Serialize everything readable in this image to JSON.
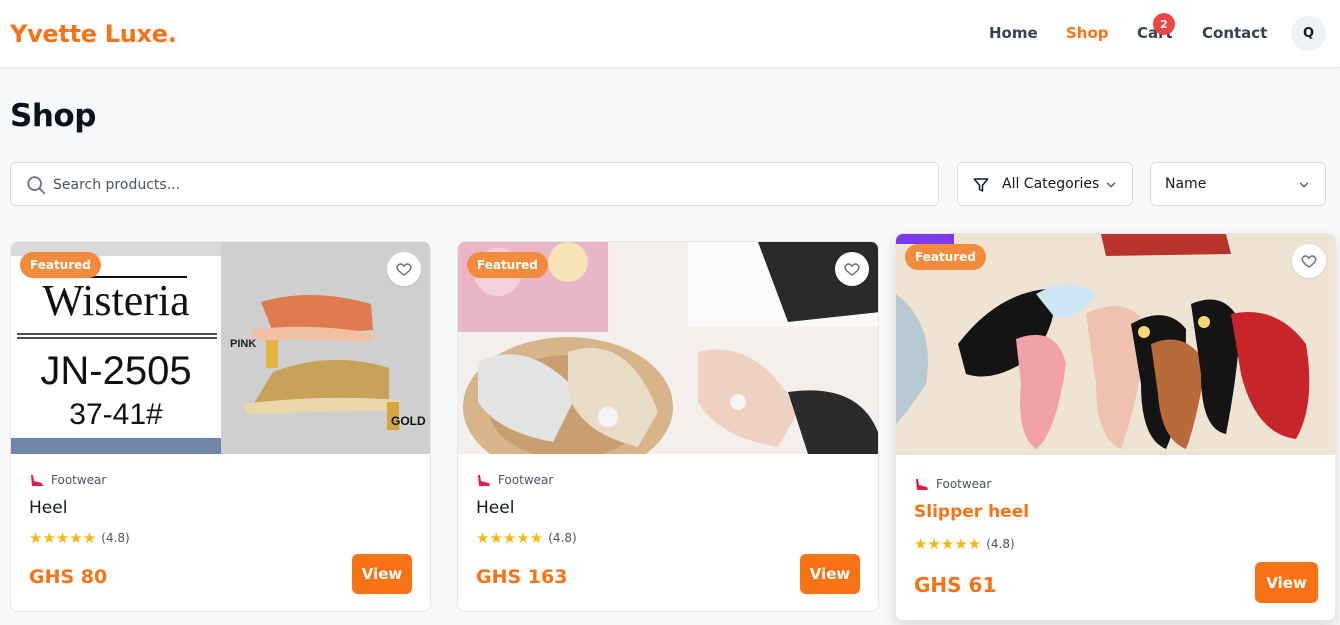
{
  "brand": {
    "name": "Yvette Luxe.",
    "accent_color": "#f97316"
  },
  "nav": {
    "home": "Home",
    "shop": "Shop",
    "cart": "Cart",
    "cart_count": "2",
    "contact": "Contact",
    "avatar_initial": "Q"
  },
  "page": {
    "title": "Shop"
  },
  "filters": {
    "search_placeholder": "Search products...",
    "search_value": "",
    "category_selected": "All Categories",
    "sort_selected": "Name"
  },
  "products": [
    {
      "badge": "Featured",
      "category": "Footwear",
      "name": "Heel",
      "stars": "★★★★★",
      "rating": "(4.8)",
      "price": "GHS 80",
      "view_label": "View",
      "image": {
        "brand_text": "Wisteria",
        "code": "JN-2505",
        "sizes": "37-41#",
        "label_pink": "PINK",
        "label_gold": "GOLD"
      }
    },
    {
      "badge": "Featured",
      "category": "Footwear",
      "name": "Heel",
      "stars": "★★★★★",
      "rating": "(4.8)",
      "price": "GHS 163",
      "view_label": "View"
    },
    {
      "badge": "Featured",
      "category": "Footwear",
      "name": "Slipper heel",
      "stars": "★★★★★",
      "rating": "(4.8)",
      "price": "GHS 61",
      "view_label": "View"
    }
  ]
}
